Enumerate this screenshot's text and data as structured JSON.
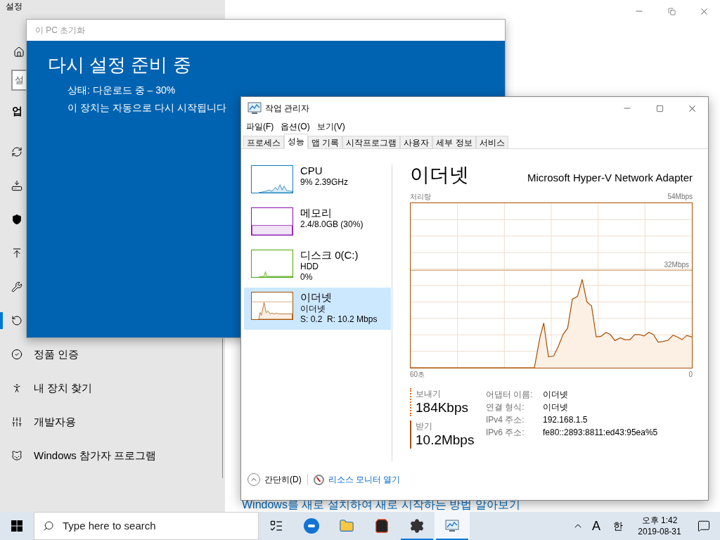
{
  "settings": {
    "title": "설정",
    "search_placeholder": "설",
    "heading": "업",
    "nav_items": [
      {
        "selected": false
      },
      {
        "selected": false
      },
      {
        "selected": false
      },
      {
        "selected": false
      },
      {
        "selected": false
      },
      {
        "selected": true
      },
      {
        "label": "정품 인증",
        "selected": false
      },
      {
        "label": "내 장치 찾기",
        "selected": false
      },
      {
        "label": "개발자용",
        "selected": false
      },
      {
        "label": "Windows 참가자 프로그램",
        "selected": false
      }
    ],
    "link": "Windows를 새로 설치하여 새로 시작하는 방법 알아보기"
  },
  "reset_dialog": {
    "title": "이 PC 초기화",
    "heading": "다시 설정 준비 중",
    "status": "상태: 다운로드 중 – 30%",
    "message": "이 장치는 자동으로 다시 시작됩니다"
  },
  "task_manager": {
    "title": "작업 관리자",
    "menu": [
      "파일(F)",
      "옵션(O)",
      "보기(V)"
    ],
    "tabs": [
      {
        "label": "프로세스",
        "selected": false
      },
      {
        "label": "성능",
        "selected": true
      },
      {
        "label": "앱 기록",
        "selected": false
      },
      {
        "label": "시작프로그램",
        "selected": false
      },
      {
        "label": "사용자",
        "selected": false
      },
      {
        "label": "세부 정보",
        "selected": false
      },
      {
        "label": "서비스",
        "selected": false
      }
    ],
    "resources": [
      {
        "name": "CPU",
        "details": [
          "9% 2.39GHz"
        ],
        "color": "#117dbb",
        "selected": false
      },
      {
        "name": "메모리",
        "details": [
          "2.4/8.0GB (30%)"
        ],
        "color": "#8b12ae",
        "selected": false
      },
      {
        "name": "디스크 0(C:)",
        "details": [
          "HDD",
          "0%"
        ],
        "color": "#4da60c",
        "selected": false
      },
      {
        "name": "이더넷",
        "details": [
          "이더넷",
          "S: 0.2  R: 10.2 Mbps"
        ],
        "color": "#a74f01",
        "selected": true
      }
    ],
    "panel": {
      "title": "이더넷",
      "adapter": "Microsoft Hyper-V Network Adapter",
      "graph": {
        "title": "처리량",
        "top_label": "54Mbps",
        "mid_label": "32Mbps",
        "start_label": "60초",
        "end_label": "0"
      },
      "send": {
        "label": "보내기",
        "value": "184Kbps"
      },
      "receive": {
        "label": "받기",
        "value": "10.2Mbps"
      },
      "properties": [
        {
          "label": "어댑터 이름:",
          "value": "이더넷"
        },
        {
          "label": "연결 형식:",
          "value": "이더넷"
        },
        {
          "label": "IPv4 주소:",
          "value": "192.168.1.5"
        },
        {
          "label": "IPv6 주소:",
          "value": "fe80::2893:8811:ed43:95ea%5"
        }
      ]
    },
    "footer": {
      "collapse": "간단히(D)",
      "link": "리소스 모니터 열기"
    }
  },
  "taskbar": {
    "search_placeholder": "Type here to search",
    "apps": [
      {
        "open": false,
        "selected": false
      },
      {
        "open": false,
        "selected": false
      },
      {
        "open": false,
        "selected": false
      },
      {
        "open": false,
        "selected": false
      },
      {
        "open": true,
        "selected": false
      },
      {
        "open": true,
        "selected": true
      }
    ],
    "tray": {
      "input_mode": "A",
      "ime": "한",
      "time": "오후 1:42",
      "date": "2019-08-31"
    }
  }
}
